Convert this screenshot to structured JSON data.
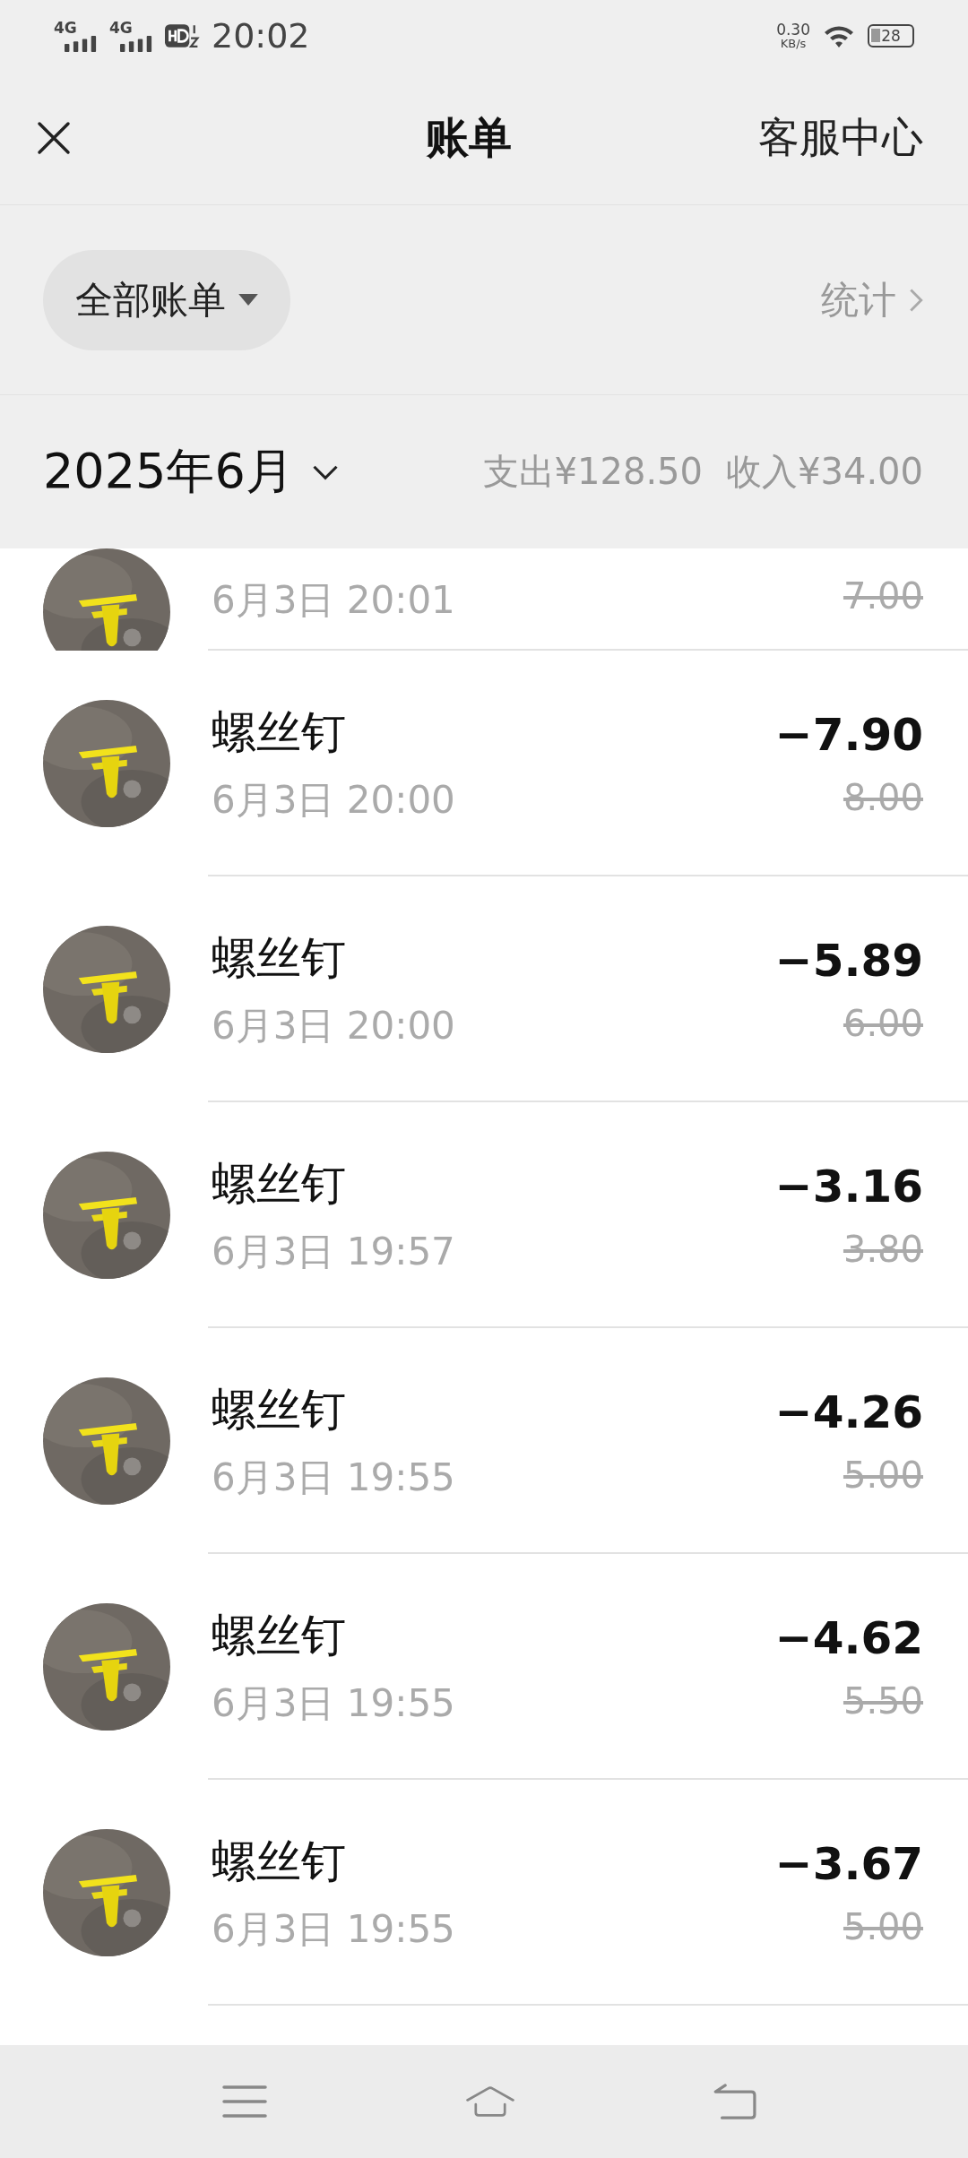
{
  "status_bar": {
    "time": "20:02",
    "net1": "4G",
    "net2": "4G",
    "speed": "0.30",
    "speed_unit": "KB/s",
    "battery": "28"
  },
  "header": {
    "title": "账单",
    "action": "客服中心"
  },
  "filter": {
    "label": "全部账单",
    "stats": "统计"
  },
  "month": {
    "label": "2025年6月",
    "expense": "支出¥128.50",
    "income": "收入¥34.00"
  },
  "transactions": [
    {
      "kind": "partial",
      "time": "6月3日 20:01",
      "original": "7.00"
    },
    {
      "kind": "full",
      "name": "螺丝钉",
      "time": "6月3日 20:00",
      "amount": "−7.90",
      "original": "8.00"
    },
    {
      "kind": "full",
      "name": "螺丝钉",
      "time": "6月3日 20:00",
      "amount": "−5.89",
      "original": "6.00"
    },
    {
      "kind": "full",
      "name": "螺丝钉",
      "time": "6月3日 19:57",
      "amount": "−3.16",
      "original": "3.80"
    },
    {
      "kind": "full",
      "name": "螺丝钉",
      "time": "6月3日 19:55",
      "amount": "−4.26",
      "original": "5.00"
    },
    {
      "kind": "full",
      "name": "螺丝钉",
      "time": "6月3日 19:55",
      "amount": "−4.62",
      "original": "5.50"
    },
    {
      "kind": "full",
      "name": "螺丝钉",
      "time": "6月3日 19:55",
      "amount": "−3.67",
      "original": "5.00"
    }
  ]
}
